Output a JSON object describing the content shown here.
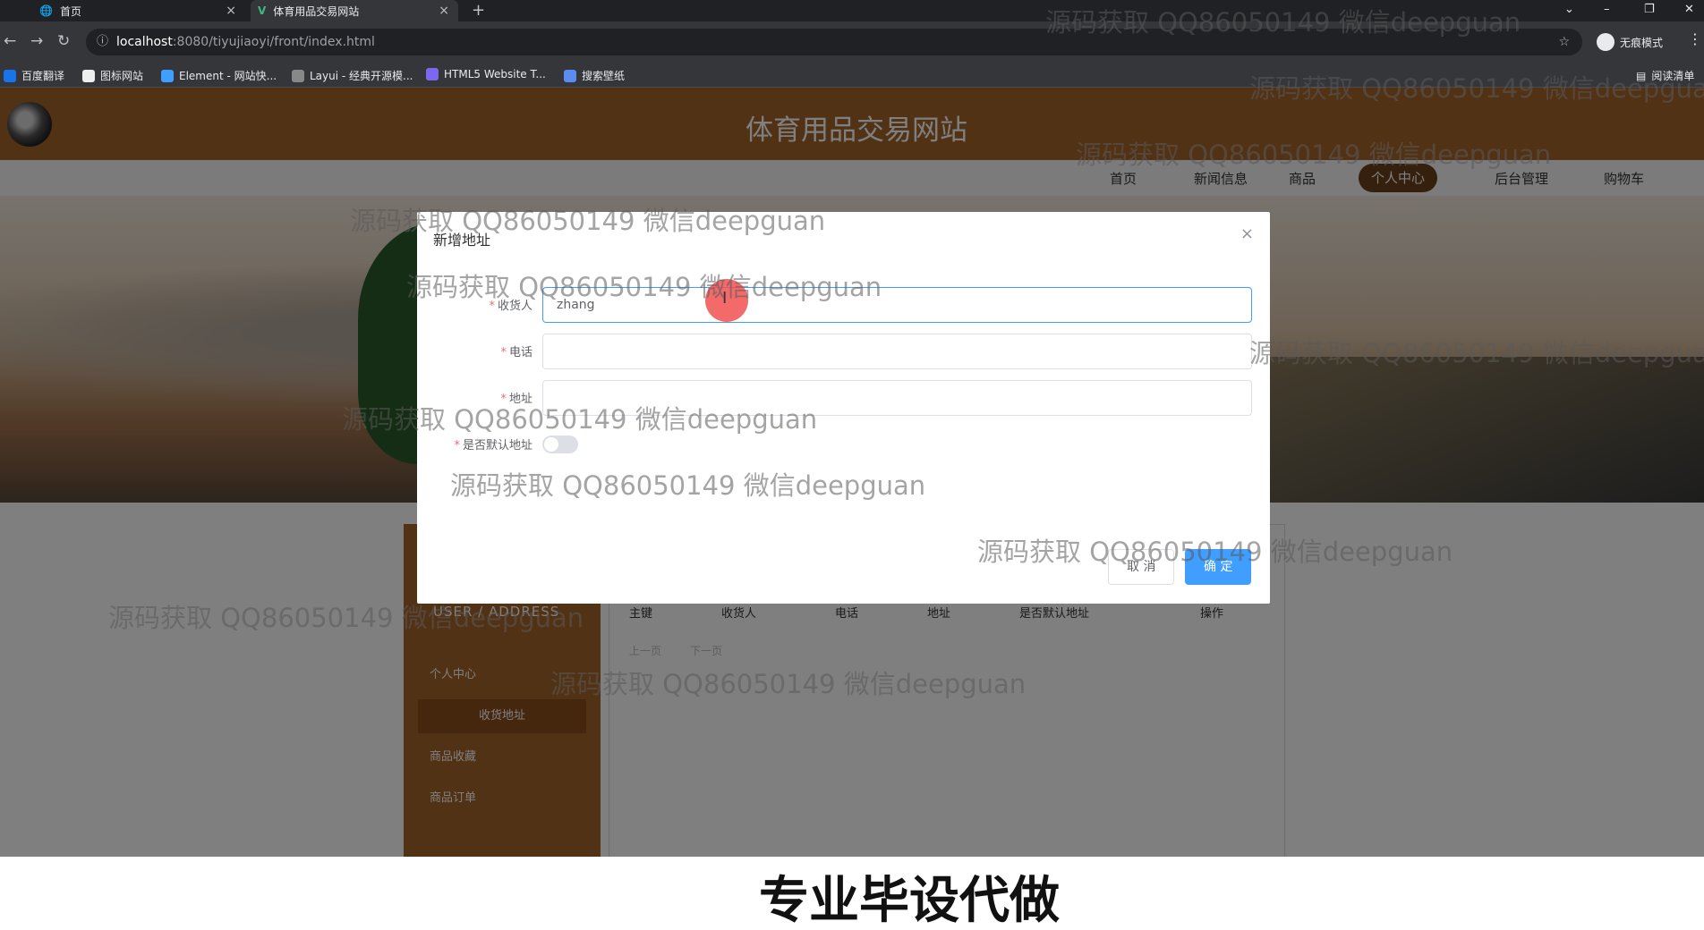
{
  "browser": {
    "tabs": [
      {
        "label": "首页",
        "close": "×"
      },
      {
        "label": "体育用品交易网站",
        "close": "×"
      }
    ],
    "new_tab": "+",
    "url_host": "localhost",
    "url_path": ":8080/tiyujiaoyi/front/index.html",
    "incognito_label": "无痕模式",
    "reading_list": "阅读清单",
    "bookmarks": [
      "百度翻译",
      "图标网站",
      "Element - 网站快...",
      "Layui - 经典开源模...",
      "HTML5 Website T...",
      "搜索壁纸"
    ]
  },
  "site": {
    "title": "体育用品交易网站",
    "nav": [
      "首页",
      "新闻信息",
      "商品",
      "个人中心",
      "后台管理",
      "购物车"
    ]
  },
  "sidebar": {
    "caption": "USER / ADDRESS",
    "items": [
      "个人中心",
      "收货地址",
      "商品收藏",
      "商品订单"
    ]
  },
  "table": {
    "headers": [
      "主键",
      "收货人",
      "电话",
      "地址",
      "是否默认地址",
      "操作"
    ],
    "pager": [
      "上一页",
      "下一页"
    ]
  },
  "dialog": {
    "title": "新增地址",
    "close": "×",
    "fields": {
      "consignee_label": "收货人",
      "consignee_value": "zhang",
      "phone_label": "电话",
      "address_label": "地址",
      "default_label": "是否默认地址"
    },
    "default_on": false,
    "cancel_label": "取 消",
    "ok_label": "确 定"
  },
  "overlay_text": {
    "watermark": "源码获取 QQ86050149 微信deepguan",
    "bottom_banner": "专业毕设代做"
  },
  "colors": {
    "header_brown": "#a5652a",
    "primary_blue": "#409eff"
  }
}
